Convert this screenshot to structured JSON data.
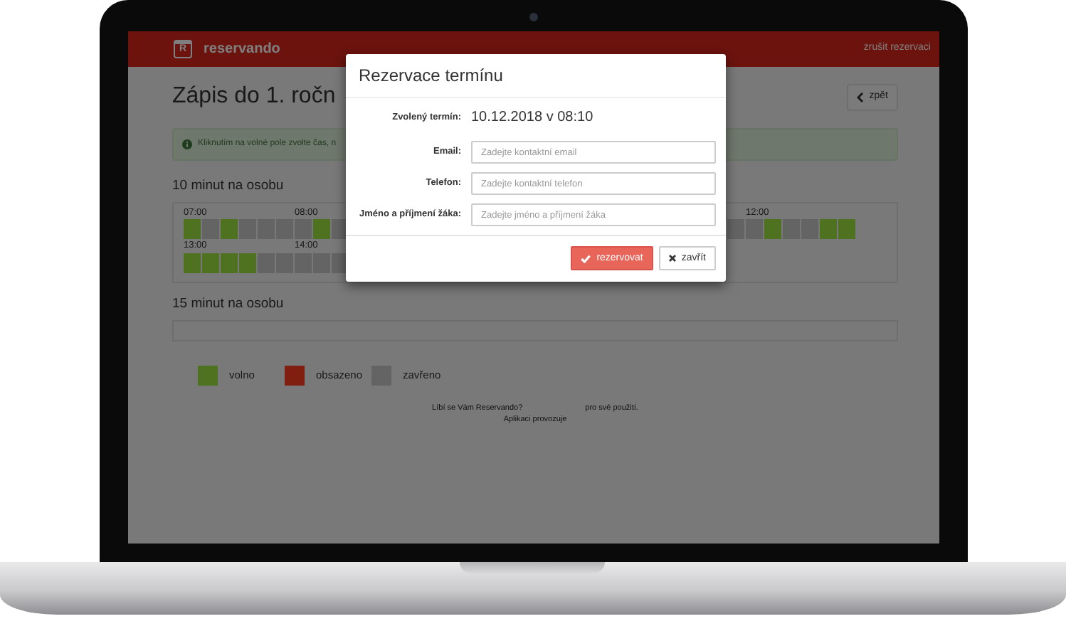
{
  "header": {
    "logo_letter": "R",
    "brand": "reservando",
    "cancel_link": "zrušit rezervaci"
  },
  "page": {
    "title": "Zápis do 1. ročn",
    "back_button": "zpět",
    "alert": "Kliknutím na volné pole zvolte čas, n"
  },
  "sections": [
    {
      "title": "10 minut na osobu",
      "rows": [
        {
          "groups": [
            {
              "slots": [
                {
                  "kind": "free",
                  "label": "07:00"
                },
                {
                  "kind": "closed"
                },
                {
                  "kind": "free"
                },
                {
                  "kind": "closed"
                },
                {
                  "kind": "closed"
                },
                {
                  "kind": "closed"
                },
                {
                  "kind": "closed",
                  "label": "08:00"
                },
                {
                  "kind": "free"
                },
                {
                  "kind": "closed"
                }
              ]
            },
            {
              "slots": [
                {
                  "kind": "closed"
                },
                {
                  "kind": "closed",
                  "label": "12:00"
                },
                {
                  "kind": "free"
                },
                {
                  "kind": "closed"
                },
                {
                  "kind": "closed"
                },
                {
                  "kind": "free"
                },
                {
                  "kind": "free"
                }
              ]
            }
          ]
        },
        {
          "groups": [
            {
              "slots": [
                {
                  "kind": "free",
                  "label": "13:00"
                },
                {
                  "kind": "free"
                },
                {
                  "kind": "free"
                },
                {
                  "kind": "free"
                },
                {
                  "kind": "closed"
                },
                {
                  "kind": "closed"
                },
                {
                  "kind": "closed",
                  "label": "14:00"
                },
                {
                  "kind": "closed"
                },
                {
                  "kind": "closed"
                }
              ]
            }
          ]
        }
      ]
    },
    {
      "title": "15 minut na osobu"
    }
  ],
  "legend": [
    {
      "label": "volno",
      "kind": "free"
    },
    {
      "label": "obsazeno",
      "kind": "taken"
    },
    {
      "label": "zavřeno",
      "kind": "closed"
    }
  ],
  "footer": [
    [
      "Líbí se Vám Reservando?",
      "pro své použití."
    ],
    [
      "Aplikaci provozuje"
    ]
  ],
  "modal": {
    "title": "Rezervace termínu",
    "fields": [
      {
        "kind": "static",
        "label": "Zvolený termín:",
        "value": "10.12.2018 v 08:10"
      },
      {
        "kind": "input",
        "label": "Email:",
        "placeholder": "Zadejte kontaktní email"
      },
      {
        "kind": "input",
        "label": "Telefon:",
        "placeholder": "Zadejte kontaktní telefon"
      },
      {
        "kind": "input",
        "label": "Jméno a příjmení žáka:",
        "placeholder": "Zadejte jméno a příjmení žáka"
      }
    ],
    "buttons": [
      {
        "kind": "primary",
        "label": "rezervovat"
      },
      {
        "kind": "default",
        "label": "zavřít"
      }
    ]
  }
}
